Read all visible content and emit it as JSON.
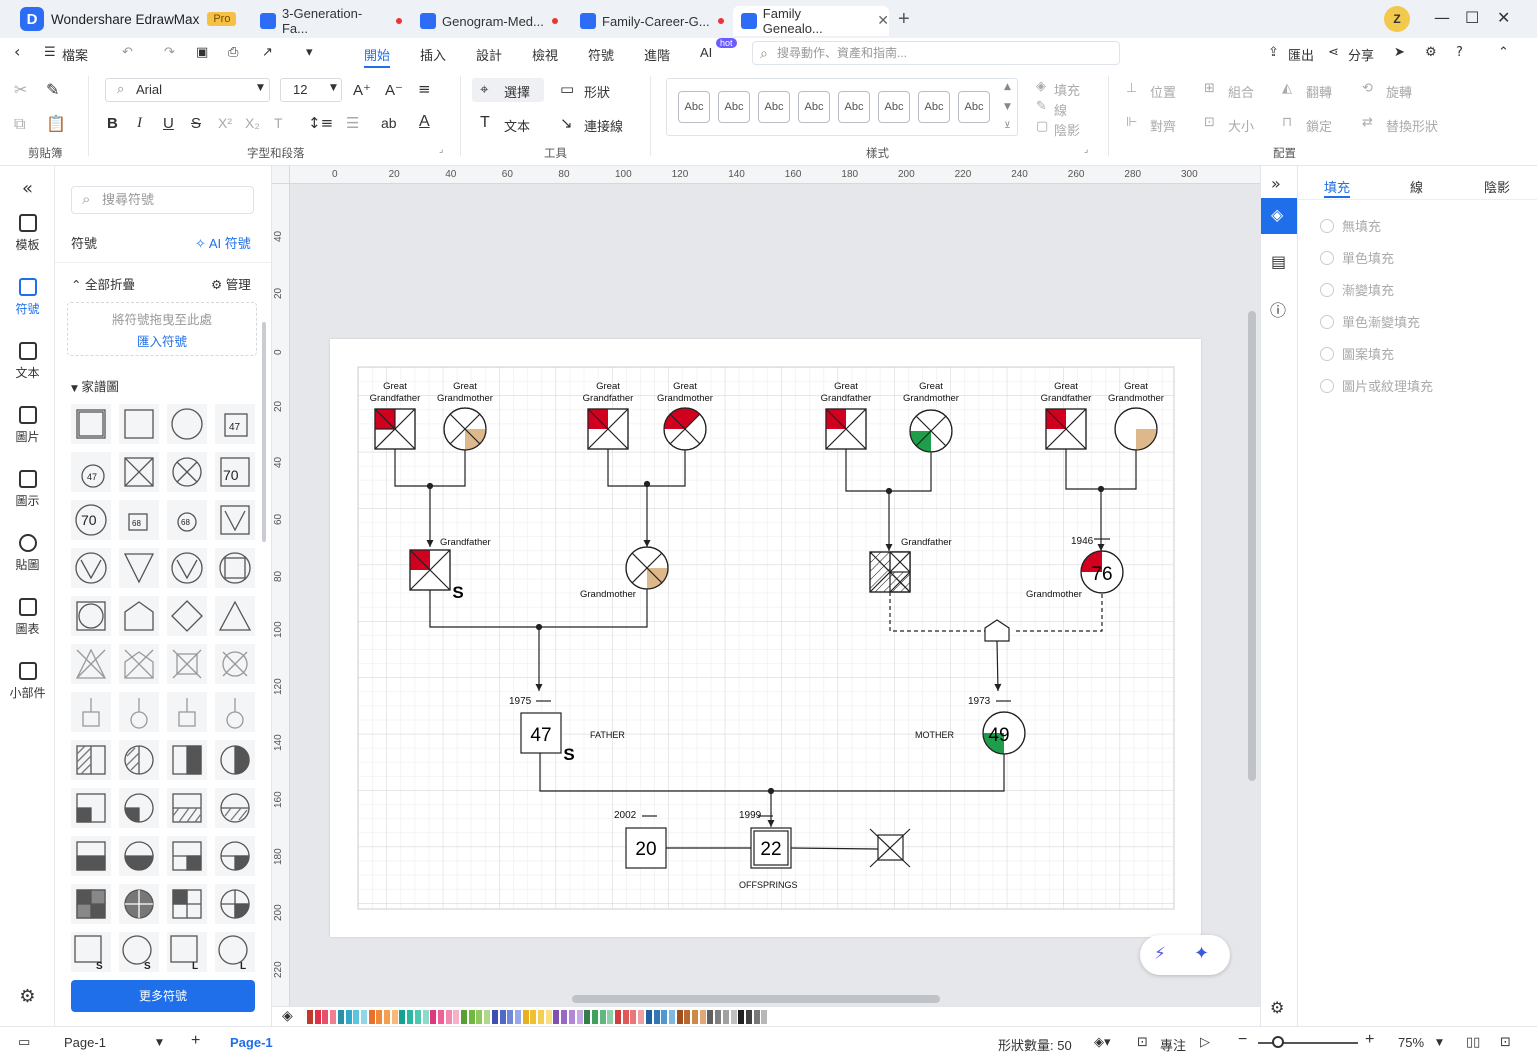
{
  "app": {
    "name": "Wondershare EdrawMax",
    "badge": "Pro"
  },
  "tabs": [
    {
      "label": "3-Generation-Fa...",
      "unsaved": true
    },
    {
      "label": "Genogram-Med...",
      "unsaved": true
    },
    {
      "label": "Family-Career-G...",
      "unsaved": true
    },
    {
      "label": "Family Genealo...",
      "active": true
    }
  ],
  "user": {
    "avatar_letter": "Z"
  },
  "menu": {
    "file": "檔案",
    "items": [
      "開始",
      "插入",
      "設計",
      "檢視",
      "符號",
      "進階",
      "AI"
    ],
    "hot_badge": "hot",
    "search_placeholder": "搜尋動作、資產和指南...",
    "export": "匯出",
    "share": "分享"
  },
  "ribbon": {
    "font": "Arial",
    "font_size": "12",
    "select": "選擇",
    "shape": "形狀",
    "text": "文本",
    "connector": "連接線",
    "style_sample": "Abc",
    "fill": "填充",
    "line": "線",
    "shadow": "陰影",
    "position": "位置",
    "group": "組合",
    "flip": "翻轉",
    "rotate": "旋轉",
    "align": "對齊",
    "size": "大小",
    "lock": "鎖定",
    "replace_shape": "替換形狀",
    "groups": {
      "clipboard": "剪貼簿",
      "font_paragraph": "字型和段落",
      "tools": "工具",
      "styles": "樣式",
      "arrange": "配置"
    }
  },
  "leftbar": [
    "模板",
    "符號",
    "文本",
    "圖片",
    "圖示",
    "貼圖",
    "圖表",
    "小部件"
  ],
  "symbols_panel": {
    "search_placeholder": "搜尋符號",
    "title": "符號",
    "ai_symbols": "AI 符號",
    "collapse_all": "全部折疊",
    "manage": "管理",
    "drop_hint": "將符號拖曳至此處",
    "import_symbols": "匯入符號",
    "category": "家譜圖",
    "more_symbols": "更多符號",
    "grid_labels": [
      "47",
      "70",
      "47",
      "68",
      "68",
      "70"
    ]
  },
  "ruler": {
    "top": [
      "0",
      "20",
      "40",
      "60",
      "80",
      "100",
      "120",
      "140",
      "160",
      "180",
      "200",
      "220",
      "240",
      "260",
      "280",
      "300"
    ],
    "left": [
      "40",
      "20",
      "0",
      "20",
      "40",
      "60",
      "80",
      "100",
      "120",
      "140",
      "160",
      "180",
      "200",
      "220"
    ]
  },
  "genogram": {
    "gen1": [
      {
        "father": "Great Grandfather",
        "mother": "Great Grandmother"
      },
      {
        "father": "Great Grandfather",
        "mother": "Great Grandmother"
      },
      {
        "father": "Great Grandfather",
        "mother": "Great Grandmother"
      },
      {
        "father": "Great Grandfather",
        "mother": "Great Grandmother"
      }
    ],
    "grandfather_label": "Grandfather",
    "grandmother_label": "Grandmother",
    "grandfather2_label": "Grandfather",
    "grandmother2_label": "Grandmother",
    "s_mark": "S",
    "grandmother2_year": "1946",
    "grandmother2_age": "76",
    "father": {
      "year": "1975",
      "age": "47",
      "label": "FATHER"
    },
    "mother": {
      "year": "1973",
      "age": "49",
      "label": "MOTHER"
    },
    "child1": {
      "year": "2002",
      "age": "20"
    },
    "child2": {
      "year": "1999",
      "age": "22"
    },
    "offsprings_label": "OFFSPRINGS",
    "colors": {
      "red": "#d2001f",
      "tan": "#dcb88a",
      "green": "#1e9e4a"
    }
  },
  "right_panel": {
    "tabs": [
      "填充",
      "線",
      "陰影"
    ],
    "fill_options": [
      "無填充",
      "單色填充",
      "漸變填充",
      "單色漸變填充",
      "圖案填充",
      "圖片或紋理填充"
    ]
  },
  "status": {
    "page_name": "Page-1",
    "page_tab": "Page-1",
    "shape_count": "形狀數量: 50",
    "focus": "專注",
    "zoom": "75%"
  },
  "palette": [
    "#c0392b",
    "#e0304a",
    "#e8506a",
    "#f08090",
    "#2a8fa8",
    "#33a9c9",
    "#5cc4dc",
    "#8fd6e8",
    "#e8702a",
    "#f08a3a",
    "#f5a050",
    "#f7b97a",
    "#18a090",
    "#2ab8a0",
    "#50c8b0",
    "#88dcc8",
    "#e03880",
    "#f06098",
    "#f488b0",
    "#f8b0c8",
    "#58a030",
    "#70b840",
    "#90c860",
    "#b0d888",
    "#4050b0",
    "#5068c8",
    "#7088d8",
    "#98a8e8",
    "#e8b020",
    "#f0c030",
    "#f5d050",
    "#f8e080",
    "#8050b0",
    "#9868c8",
    "#b088d8",
    "#c8a8e8",
    "#308048",
    "#40a060",
    "#60b880",
    "#90d0a8",
    "#d04040",
    "#e05858",
    "#e87878",
    "#f0a0a0",
    "#2060a0",
    "#3078b8",
    "#5098d0",
    "#80b8e0",
    "#a05020",
    "#b86830",
    "#d08848",
    "#e0a878",
    "#606060",
    "#808080",
    "#a0a0a0",
    "#c0c0c0",
    "#202020",
    "#404040",
    "#787878",
    "#b8b8b8"
  ]
}
